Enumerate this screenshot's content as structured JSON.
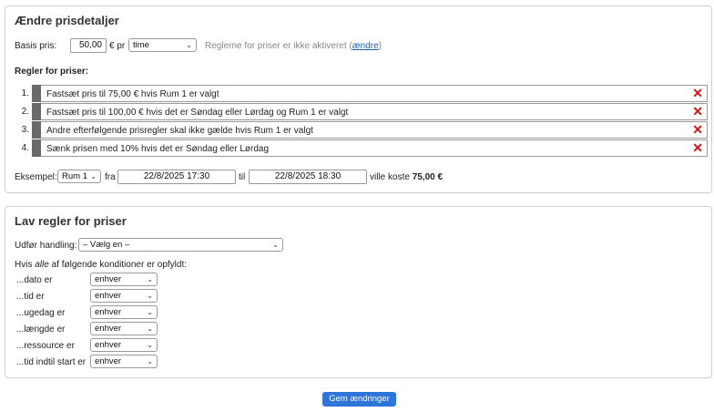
{
  "prices": {
    "title": "Ændre prisdetaljer",
    "base_label": "Basis pris:",
    "base_value": "50,00",
    "per_label": "€ pr",
    "unit_select": "time",
    "status_text": "Reglerne for priser er ikke aktiveret (",
    "status_link": "ændre",
    "status_close": ")",
    "rules_label": "Regler for priser:",
    "rules": [
      {
        "num": "1.",
        "text": "Fastsæt pris til 75,00 € hvis Rum 1 er valgt"
      },
      {
        "num": "2.",
        "text": "Fastsæt pris til 100,00 € hvis det er Søndag eller Lørdag og Rum 1 er valgt"
      },
      {
        "num": "3.",
        "text": "Andre efterfølgende prisregler skal ikke gælde hvis Rum 1 er valgt"
      },
      {
        "num": "4.",
        "text": "Sænk prisen med 10% hvis det er Søndag eller Lørdag"
      }
    ],
    "delete_glyph": "✕",
    "example_label": "Eksempel:",
    "example_room": "Rum 1",
    "from_label": "fra",
    "from_value": "22/8/2025 17:30",
    "to_label": "til",
    "to_value": "22/8/2025 18:30",
    "cost_label": "ville koste",
    "cost_value": "75,00 €"
  },
  "make_rules": {
    "title": "Lav regler for priser",
    "action_label": "Udfør handling:",
    "action_select": "– Vælg en –",
    "cond_intro_pre": "Hvis ",
    "cond_intro_em": "alle",
    "cond_intro_post": " af følgende konditioner er opfyldt:",
    "conditions": [
      {
        "label": "...dato er",
        "value": "enhver"
      },
      {
        "label": "...tid er",
        "value": "enhver"
      },
      {
        "label": "...ugedag er",
        "value": "enhver"
      },
      {
        "label": "...længde er",
        "value": "enhver"
      },
      {
        "label": "...ressource er",
        "value": "enhver"
      },
      {
        "label": "...tid indtil start er",
        "value": "enhver"
      }
    ]
  },
  "save_label": "Gem ændringer",
  "colors": {
    "accent": "#2f74d8",
    "delete": "#d41414",
    "handle": "#6a6a6a"
  },
  "icons": {
    "delete": "close-icon",
    "dropdown": "chevron-down-icon"
  }
}
